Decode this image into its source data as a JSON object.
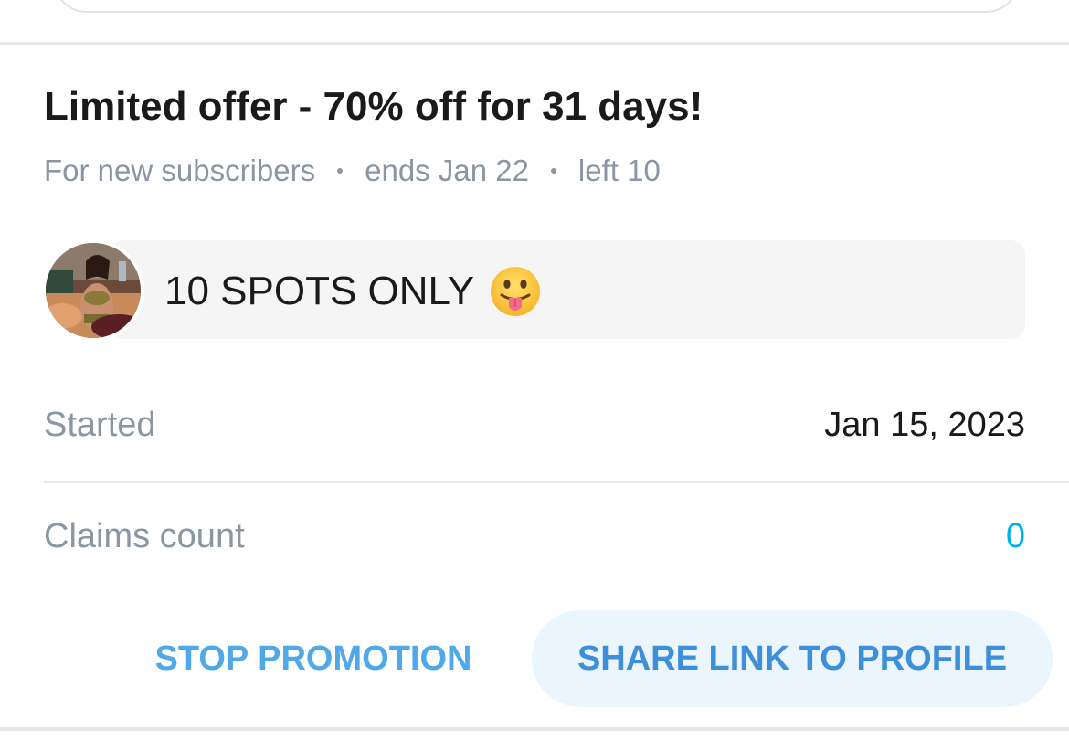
{
  "offer": {
    "title": "Limited offer - 70% off for 31 days!",
    "audience": "For new subscribers",
    "ends": "ends Jan 22",
    "left": "left 10"
  },
  "message": {
    "text": "10 SPOTS ONLY",
    "emoji": "tongue-out-face-icon"
  },
  "details": {
    "started_label": "Started",
    "started_value": "Jan 15, 2023",
    "claims_label": "Claims count",
    "claims_value": "0"
  },
  "actions": {
    "stop_label": "STOP PROMOTION",
    "share_label": "SHARE LINK TO PROFILE"
  },
  "colors": {
    "accent_blue": "#00aff0",
    "muted_text": "#8a96a3",
    "button_blue": "#4fa8e8",
    "share_bg": "#ebf5fd"
  }
}
